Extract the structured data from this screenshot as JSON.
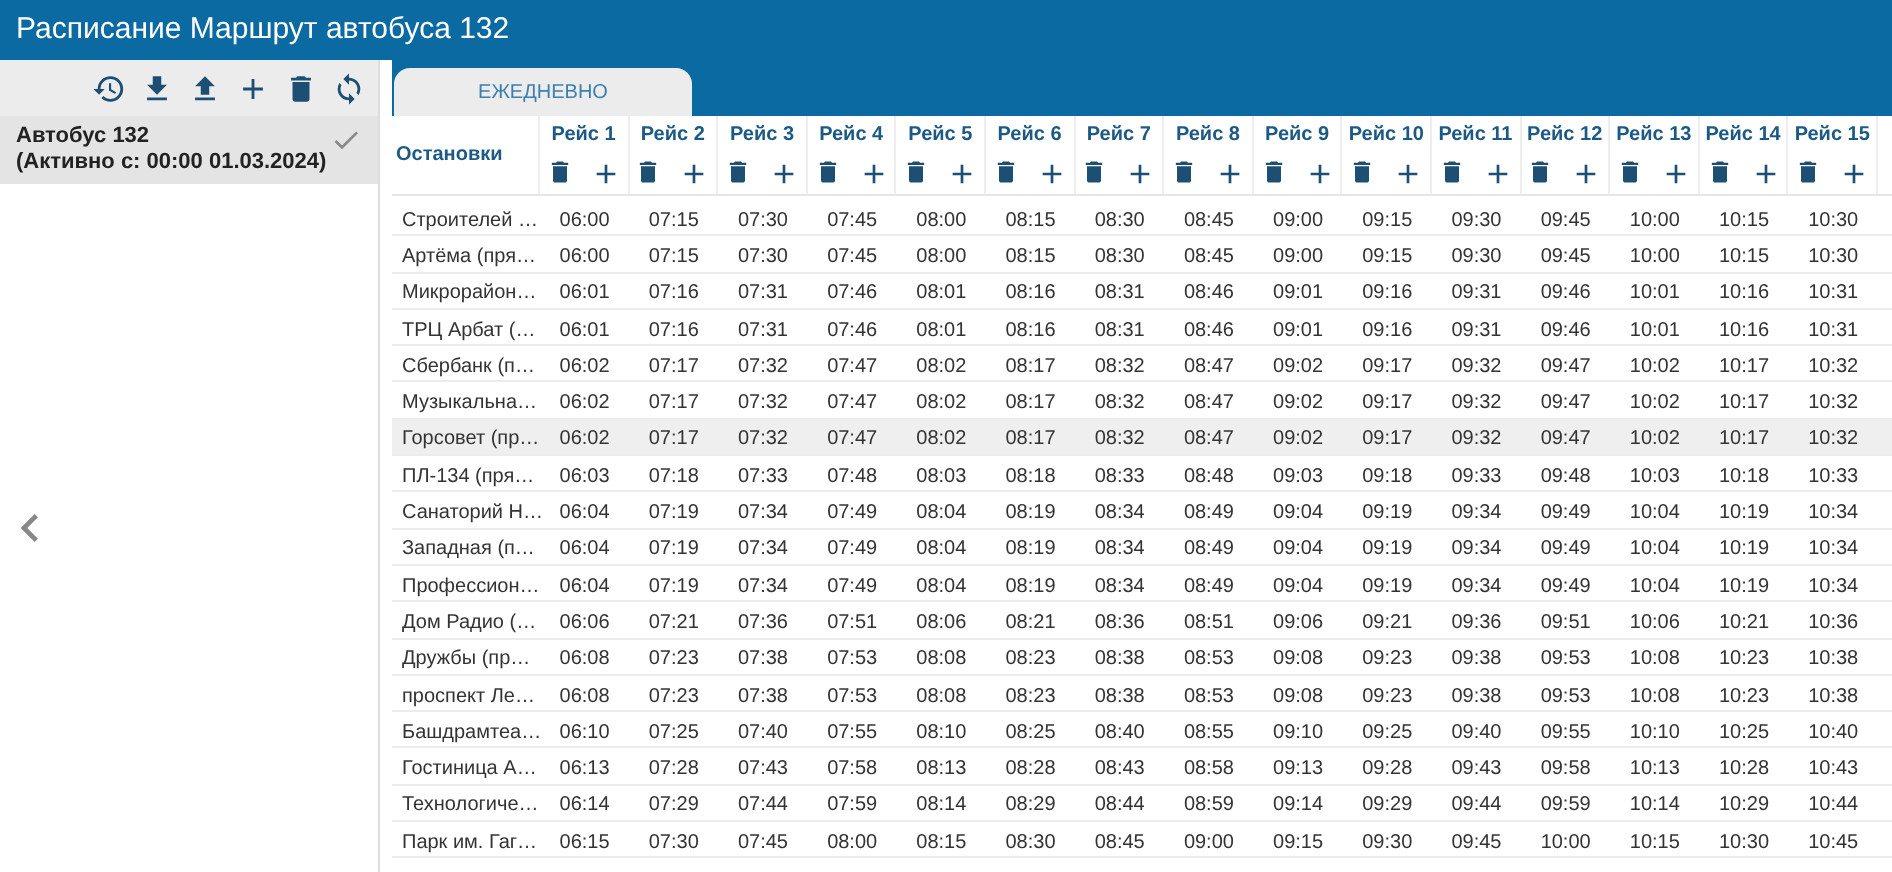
{
  "window": {
    "title": "Расписание Маршрут автобуса 132"
  },
  "sidebar": {
    "items": [
      {
        "title": "Автобус 132",
        "subtitle": "(Активно с: 00:00 01.03.2024)",
        "selected": true,
        "active": true
      }
    ]
  },
  "tabs": [
    {
      "label": "ЕЖЕДНЕВНО",
      "selected": true
    }
  ],
  "table": {
    "stops_header": "Остановки",
    "columns": [
      "Рейс 1",
      "Рейс 2",
      "Рейс 3",
      "Рейс 4",
      "Рейс 5",
      "Рейс 6",
      "Рейс 7",
      "Рейс 8",
      "Рейс 9",
      "Рейс 10",
      "Рейс 11",
      "Рейс 12",
      "Рейс 13",
      "Рейс 14",
      "Рейс 15"
    ],
    "rows": [
      {
        "stop": "Строителей …",
        "selected": false,
        "times": [
          "06:00",
          "07:15",
          "07:30",
          "07:45",
          "08:00",
          "08:15",
          "08:30",
          "08:45",
          "09:00",
          "09:15",
          "09:30",
          "09:45",
          "10:00",
          "10:15",
          "10:30"
        ]
      },
      {
        "stop": "Артёма (пря…",
        "selected": false,
        "times": [
          "06:00",
          "07:15",
          "07:30",
          "07:45",
          "08:00",
          "08:15",
          "08:30",
          "08:45",
          "09:00",
          "09:15",
          "09:30",
          "09:45",
          "10:00",
          "10:15",
          "10:30"
        ]
      },
      {
        "stop": "Микрорайон…",
        "selected": false,
        "times": [
          "06:01",
          "07:16",
          "07:31",
          "07:46",
          "08:01",
          "08:16",
          "08:31",
          "08:46",
          "09:01",
          "09:16",
          "09:31",
          "09:46",
          "10:01",
          "10:16",
          "10:31"
        ]
      },
      {
        "stop": "ТРЦ Арбат (…",
        "selected": false,
        "times": [
          "06:01",
          "07:16",
          "07:31",
          "07:46",
          "08:01",
          "08:16",
          "08:31",
          "08:46",
          "09:01",
          "09:16",
          "09:31",
          "09:46",
          "10:01",
          "10:16",
          "10:31"
        ]
      },
      {
        "stop": "Сбербанк (п…",
        "selected": false,
        "times": [
          "06:02",
          "07:17",
          "07:32",
          "07:47",
          "08:02",
          "08:17",
          "08:32",
          "08:47",
          "09:02",
          "09:17",
          "09:32",
          "09:47",
          "10:02",
          "10:17",
          "10:32"
        ]
      },
      {
        "stop": "Музыкальна…",
        "selected": false,
        "times": [
          "06:02",
          "07:17",
          "07:32",
          "07:47",
          "08:02",
          "08:17",
          "08:32",
          "08:47",
          "09:02",
          "09:17",
          "09:32",
          "09:47",
          "10:02",
          "10:17",
          "10:32"
        ]
      },
      {
        "stop": "Горсовет (пр…",
        "selected": true,
        "times": [
          "06:02",
          "07:17",
          "07:32",
          "07:47",
          "08:02",
          "08:17",
          "08:32",
          "08:47",
          "09:02",
          "09:17",
          "09:32",
          "09:47",
          "10:02",
          "10:17",
          "10:32"
        ]
      },
      {
        "stop": "ПЛ-134 (пря…",
        "selected": false,
        "times": [
          "06:03",
          "07:18",
          "07:33",
          "07:48",
          "08:03",
          "08:18",
          "08:33",
          "08:48",
          "09:03",
          "09:18",
          "09:33",
          "09:48",
          "10:03",
          "10:18",
          "10:33"
        ]
      },
      {
        "stop": "Санаторий Н…",
        "selected": false,
        "times": [
          "06:04",
          "07:19",
          "07:34",
          "07:49",
          "08:04",
          "08:19",
          "08:34",
          "08:49",
          "09:04",
          "09:19",
          "09:34",
          "09:49",
          "10:04",
          "10:19",
          "10:34"
        ]
      },
      {
        "stop": "Западная (п…",
        "selected": false,
        "times": [
          "06:04",
          "07:19",
          "07:34",
          "07:49",
          "08:04",
          "08:19",
          "08:34",
          "08:49",
          "09:04",
          "09:19",
          "09:34",
          "09:49",
          "10:04",
          "10:19",
          "10:34"
        ]
      },
      {
        "stop": "Профессион…",
        "selected": false,
        "times": [
          "06:04",
          "07:19",
          "07:34",
          "07:49",
          "08:04",
          "08:19",
          "08:34",
          "08:49",
          "09:04",
          "09:19",
          "09:34",
          "09:49",
          "10:04",
          "10:19",
          "10:34"
        ]
      },
      {
        "stop": "Дом Радио (…",
        "selected": false,
        "times": [
          "06:06",
          "07:21",
          "07:36",
          "07:51",
          "08:06",
          "08:21",
          "08:36",
          "08:51",
          "09:06",
          "09:21",
          "09:36",
          "09:51",
          "10:06",
          "10:21",
          "10:36"
        ]
      },
      {
        "stop": "Дружбы (пр…",
        "selected": false,
        "times": [
          "06:08",
          "07:23",
          "07:38",
          "07:53",
          "08:08",
          "08:23",
          "08:38",
          "08:53",
          "09:08",
          "09:23",
          "09:38",
          "09:53",
          "10:08",
          "10:23",
          "10:38"
        ]
      },
      {
        "stop": "проспект Ле…",
        "selected": false,
        "times": [
          "06:08",
          "07:23",
          "07:38",
          "07:53",
          "08:08",
          "08:23",
          "08:38",
          "08:53",
          "09:08",
          "09:23",
          "09:38",
          "09:53",
          "10:08",
          "10:23",
          "10:38"
        ]
      },
      {
        "stop": "Башдрамтеа…",
        "selected": false,
        "times": [
          "06:10",
          "07:25",
          "07:40",
          "07:55",
          "08:10",
          "08:25",
          "08:40",
          "08:55",
          "09:10",
          "09:25",
          "09:40",
          "09:55",
          "10:10",
          "10:25",
          "10:40"
        ]
      },
      {
        "stop": "Гостиница А…",
        "selected": false,
        "times": [
          "06:13",
          "07:28",
          "07:43",
          "07:58",
          "08:13",
          "08:28",
          "08:43",
          "08:58",
          "09:13",
          "09:28",
          "09:43",
          "09:58",
          "10:13",
          "10:28",
          "10:43"
        ]
      },
      {
        "stop": "Технологиче…",
        "selected": false,
        "times": [
          "06:14",
          "07:29",
          "07:44",
          "07:59",
          "08:14",
          "08:29",
          "08:44",
          "08:59",
          "09:14",
          "09:29",
          "09:44",
          "09:59",
          "10:14",
          "10:29",
          "10:44"
        ]
      },
      {
        "stop": "Парк им. Гаг…",
        "selected": false,
        "times": [
          "06:15",
          "07:30",
          "07:45",
          "08:00",
          "08:15",
          "08:30",
          "08:45",
          "09:00",
          "09:15",
          "09:30",
          "09:45",
          "10:00",
          "10:15",
          "10:30",
          "10:45"
        ]
      }
    ]
  }
}
